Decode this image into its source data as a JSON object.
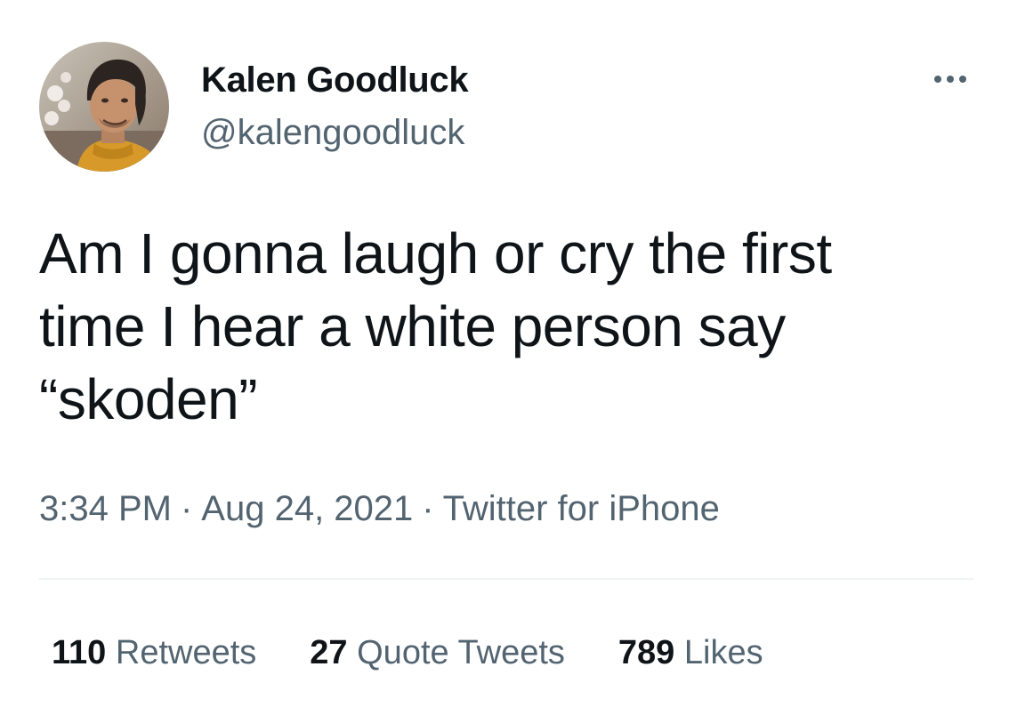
{
  "tweet": {
    "author": {
      "name": "Kalen Goodluck",
      "handle": "@kalengoodluck"
    },
    "text": "Am I gonna laugh or cry the first\ntime I hear a white person say\n“skoden”",
    "time": "3:34 PM",
    "separator": "·",
    "date": "Aug 24, 2021",
    "source": "Twitter for iPhone",
    "stats": {
      "retweets_count": "110",
      "retweets_label": "Retweets",
      "quote_count": "27",
      "quote_label": "Quote Tweets",
      "likes_count": "789",
      "likes_label": "Likes"
    },
    "more_icon": "more-horizontal-icon"
  },
  "colors": {
    "text_primary": "#0f1419",
    "text_secondary": "#536471",
    "divider": "#eff3f4",
    "background": "#ffffff"
  }
}
